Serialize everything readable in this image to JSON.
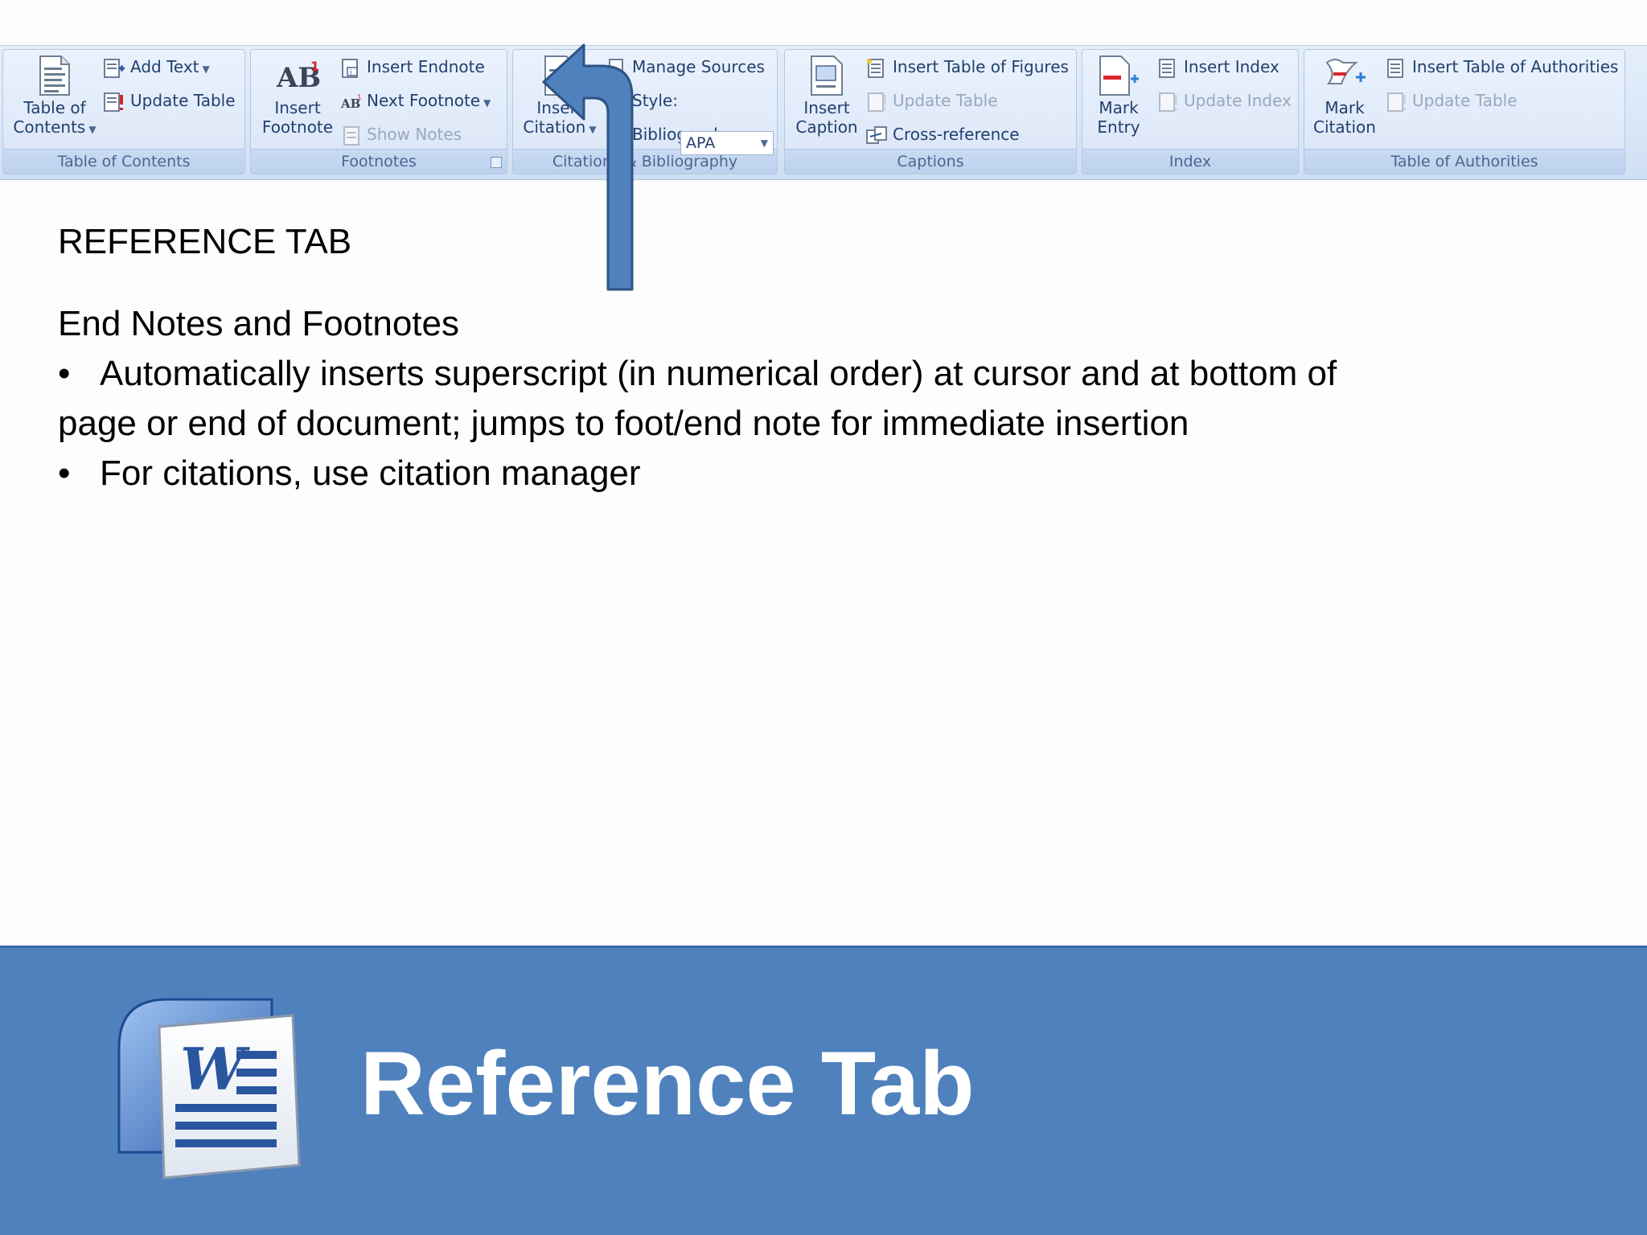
{
  "ribbon": {
    "groups": {
      "toc": {
        "label": "Table of Contents",
        "big_button": {
          "line1": "Table of",
          "line2": "Contents",
          "icon": "table-of-contents-icon"
        },
        "add_text": "Add Text",
        "update_table": "Update Table"
      },
      "footnotes": {
        "label": "Footnotes",
        "big_button": {
          "line1": "Insert",
          "line2": "Footnote",
          "icon": "insert-footnote-icon"
        },
        "insert_endnote": "Insert Endnote",
        "next_footnote": "Next Footnote",
        "show_notes": "Show Notes"
      },
      "citations": {
        "label": "Citations & Bibliography",
        "big_button": {
          "line1": "Insert",
          "line2": "Citation",
          "icon": "insert-citation-icon"
        },
        "manage_sources": "Manage Sources",
        "style_label": "Style:",
        "style_value": "APA",
        "bibliography": "Bibliography"
      },
      "captions": {
        "label": "Captions",
        "big_button": {
          "line1": "Insert",
          "line2": "Caption",
          "icon": "insert-caption-icon"
        },
        "insert_table_of_figures": "Insert Table of Figures",
        "update_table": "Update Table",
        "cross_reference": "Cross-reference"
      },
      "index": {
        "label": "Index",
        "big_button": {
          "line1": "Mark",
          "line2": "Entry",
          "icon": "mark-entry-icon"
        },
        "insert_index": "Insert Index",
        "update_index": "Update Index"
      },
      "authorities": {
        "label": "Table of Authorities",
        "big_button": {
          "line1": "Mark",
          "line2": "Citation",
          "icon": "mark-citation-icon"
        },
        "insert_table_of_authorities": "Insert Table of Authorities",
        "update_table": "Update Table"
      }
    }
  },
  "content": {
    "heading": "REFERENCE TAB",
    "subheading": "End Notes and Footnotes",
    "bullet_char": "•",
    "bullet1_line1": "Automatically inserts superscript (in numerical order) at cursor and at bottom of",
    "bullet1_line2": "page or end of document; jumps to foot/end note for immediate insertion",
    "bullet2": "For citations, use citation manager"
  },
  "footer": {
    "title": "Reference Tab",
    "logo_letter": "W"
  },
  "colors": {
    "footer_bg": "#4f81bd",
    "arrow_fill": "#4f81bd",
    "arrow_stroke": "#2c5384"
  }
}
